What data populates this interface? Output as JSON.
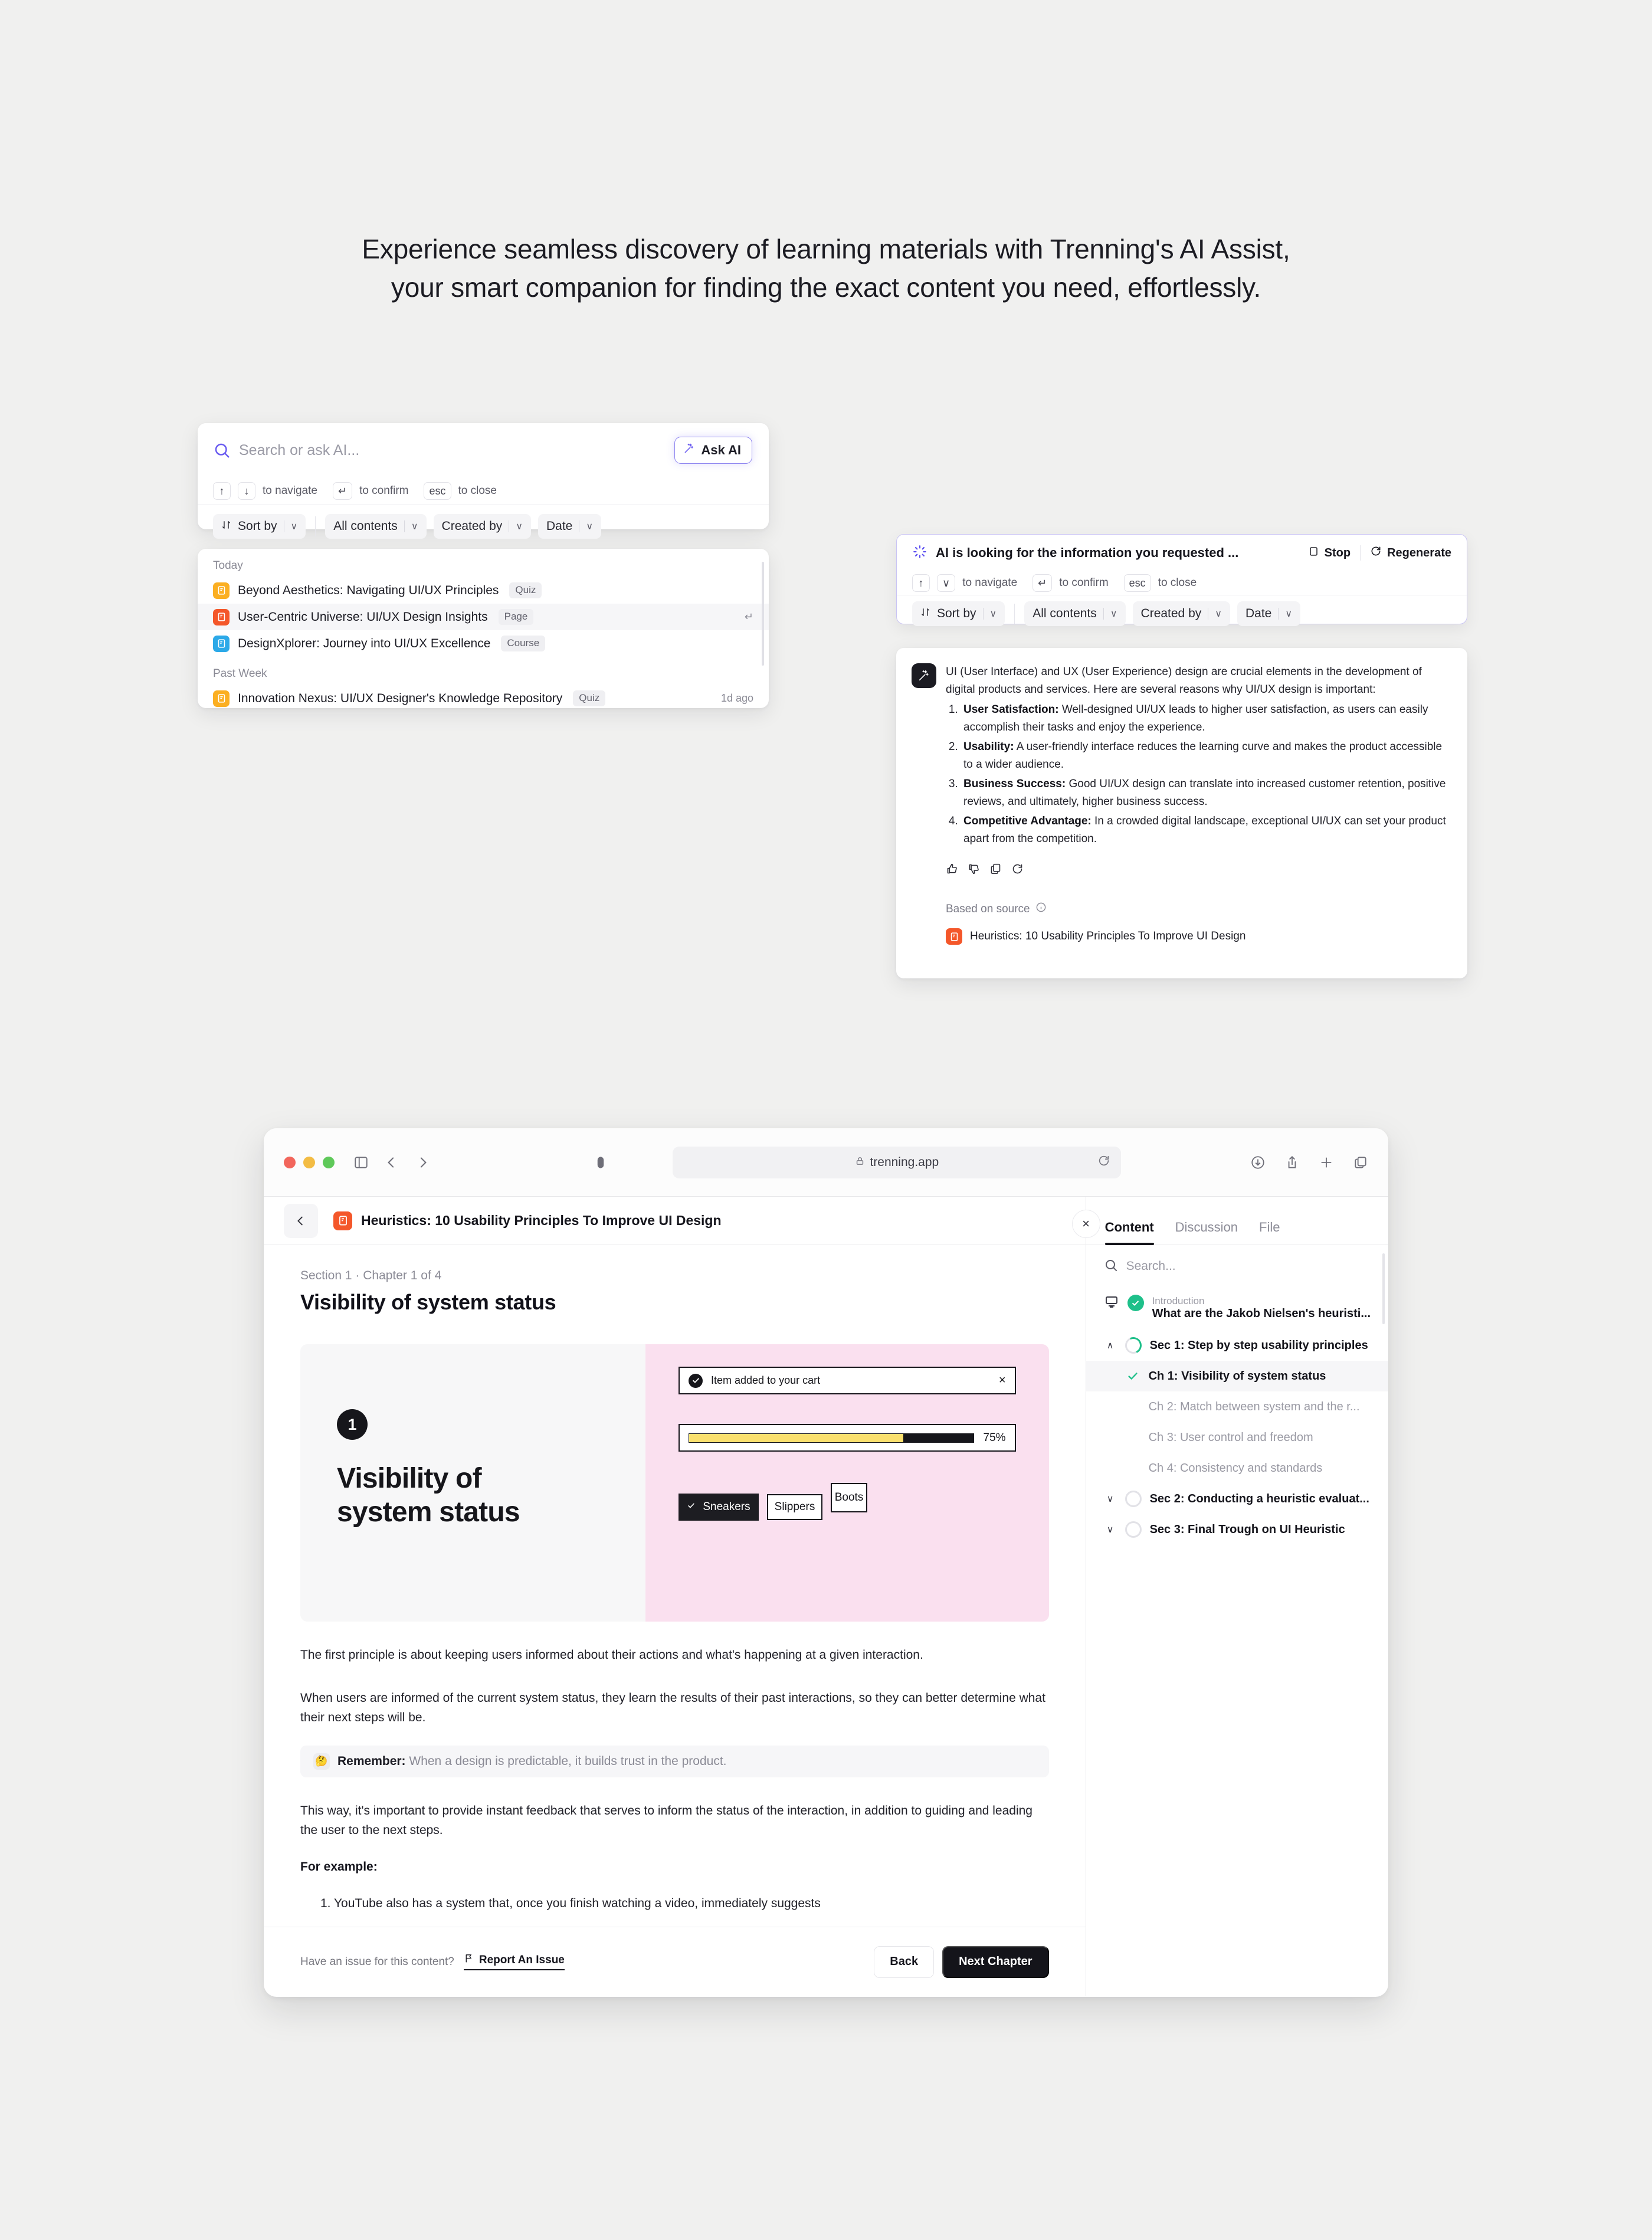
{
  "headline": {
    "line1": "Experience seamless discovery of learning materials with Trenning's AI Assist,",
    "line2": "your smart companion for finding the exact content you need, effortlessly."
  },
  "search_panel": {
    "input_value": "",
    "placeholder": "Search or ask AI...",
    "ask_ai_label": "Ask AI",
    "hints": {
      "up_key": "↑",
      "down_key": "↓",
      "navigate_text": "to navigate",
      "enter_key": "↵",
      "confirm_text": "to confirm",
      "esc_key": "esc",
      "close_text": "to close"
    },
    "filters": [
      {
        "label": "Sort by",
        "chevron": "∨"
      },
      {
        "label": "All contents",
        "chevron": "∨"
      },
      {
        "label": "Created by",
        "chevron": "∨"
      },
      {
        "label": "Date",
        "chevron": "∨"
      }
    ]
  },
  "results": {
    "groups": [
      {
        "label": "Today",
        "items": [
          {
            "title": "Beyond Aesthetics: Navigating UI/UX Principles",
            "badge": "Quiz",
            "color": "#fbaf22",
            "meta": "",
            "enter_hint": "",
            "selected": false
          },
          {
            "title": "User-Centric Universe: UI/UX Design Insights",
            "badge": "Page",
            "color": "#f4572a",
            "meta": "",
            "enter_hint": "↵",
            "selected": true
          },
          {
            "title": "DesignXplorer: Journey into UI/UX Excellence",
            "badge": "Course",
            "color": "#2ca9e8",
            "meta": "",
            "enter_hint": "",
            "selected": false
          }
        ]
      },
      {
        "label": "Past Week",
        "items": [
          {
            "title": "Innovation Nexus: UI/UX Designer's Knowledge Repository",
            "badge": "Quiz",
            "color": "#fbaf22",
            "meta": "1d ago",
            "enter_hint": "",
            "selected": false
          }
        ]
      }
    ]
  },
  "ai_status": {
    "title": "AI is looking for the information you requested ...",
    "stop_label": "Stop",
    "regenerate_label": "Regenerate",
    "hints": {
      "up_key": "↑",
      "down_key": "∨",
      "navigate_text": "to navigate",
      "enter_key": "↵",
      "confirm_text": "to confirm",
      "esc_key": "esc",
      "close_text": "to close"
    },
    "filters": [
      {
        "label": "Sort by",
        "chevron": "∨"
      },
      {
        "label": "All contents",
        "chevron": "∨"
      },
      {
        "label": "Created by",
        "chevron": "∨"
      },
      {
        "label": "Date",
        "chevron": "∨"
      }
    ]
  },
  "ai_answer": {
    "intro": "UI (User Interface) and UX (User Experience) design are crucial elements in the development of digital products and services. Here are several reasons why UI/UX design is important:",
    "items": [
      {
        "term": "User Satisfaction:",
        "text": " Well-designed UI/UX leads to higher user satisfaction, as users can easily accomplish their tasks and enjoy the experience."
      },
      {
        "term": "Usability:",
        "text": " A user-friendly interface reduces the learning curve and makes the product accessible to a wider audience."
      },
      {
        "term": "Business Success:",
        "text": " Good UI/UX design can translate into increased customer retention, positive reviews, and ultimately, higher business success."
      },
      {
        "term": "Competitive Advantage:",
        "text": " In a crowded digital landscape, exceptional UI/UX can set your product apart from the competition."
      }
    ],
    "source_label": "Based on source",
    "source_title": "Heuristics: 10 Usability Principles To Improve UI Design"
  },
  "browser": {
    "url": "trenning.app",
    "traffic_lights": [
      "#f2665c",
      "#f3bc44",
      "#60c martin"
    ],
    "app": {
      "doc_title": "Heuristics: 10 Usability Principles To Improve UI Design",
      "breadcrumb": "Section 1 · Chapter 1 of 4",
      "chapter_title": "Visibility of system status",
      "illustration": {
        "number": "1",
        "heading_line1": "Visibility of",
        "heading_line2": "system status",
        "toast_text": "Item added to your cart",
        "toast_close": "×",
        "progress_percent": "75%",
        "progress_value": 75,
        "chips": [
          "Sneakers",
          "Slippers",
          "Boots"
        ]
      },
      "paragraphs": {
        "p1": "The first principle is about keeping users informed about their actions and what's happening at a given interaction.",
        "p2": "When users are informed of the current system status, they learn the results of their past interactions, so they can better determine what their next steps will be.",
        "remember_label": "Remember:",
        "remember_text": " When a design is predictable, it builds trust in the product.",
        "p3": "This way, it's important to provide instant feedback that serves to inform the status of the interaction, in addition to guiding and leading the user to the next steps.",
        "for_example": "For example:",
        "example_1": "1. YouTube also has a system that, once you finish watching a video, immediately suggests"
      },
      "footer": {
        "question": "Have an issue for this content?",
        "report_label": "Report An Issue",
        "back_label": "Back",
        "next_label": "Next Chapter"
      },
      "sidebar": {
        "tabs": [
          {
            "label": "Content",
            "active": true
          },
          {
            "label": "Discussion",
            "active": false
          },
          {
            "label": "File",
            "active": false
          }
        ],
        "close_icon": "×",
        "search_placeholder": "Search...",
        "search_value": "",
        "tree": [
          {
            "kind": "intro",
            "eyebrow": "Introduction",
            "label": "What are the Jakob Nielsen's heuristi...",
            "state": "done"
          },
          {
            "kind": "section",
            "label": "Sec 1: Step by step usability principles",
            "state": "partial",
            "expanded": true,
            "chevron": "∧"
          },
          {
            "kind": "chapter",
            "label": "Ch 1: Visibility of system status",
            "state": "check",
            "current": true
          },
          {
            "kind": "chapter",
            "label": "Ch 2: Match between system and the r...",
            "state": "none",
            "current": false
          },
          {
            "kind": "chapter",
            "label": "Ch 3: User control and freedom",
            "state": "none",
            "current": false
          },
          {
            "kind": "chapter",
            "label": "Ch 4: Consistency and standards",
            "state": "none",
            "current": false
          },
          {
            "kind": "section",
            "label": "Sec 2: Conducting a heuristic evaluat...",
            "state": "empty",
            "expanded": false,
            "chevron": "∨"
          },
          {
            "kind": "section",
            "label": "Sec 3: Final Trough on UI Heuristic",
            "state": "empty",
            "expanded": false,
            "chevron": "∨"
          }
        ]
      }
    }
  },
  "colors": {
    "accent_purple": "#8f86f0",
    "brand_orange": "#f4572a",
    "quiz_yellow": "#fbaf22",
    "course_blue": "#2ca9e8",
    "progress_yellow": "#fae06e",
    "pink_panel": "#fae0ef",
    "green_check": "#1ec08a",
    "dark": "#16161b"
  }
}
